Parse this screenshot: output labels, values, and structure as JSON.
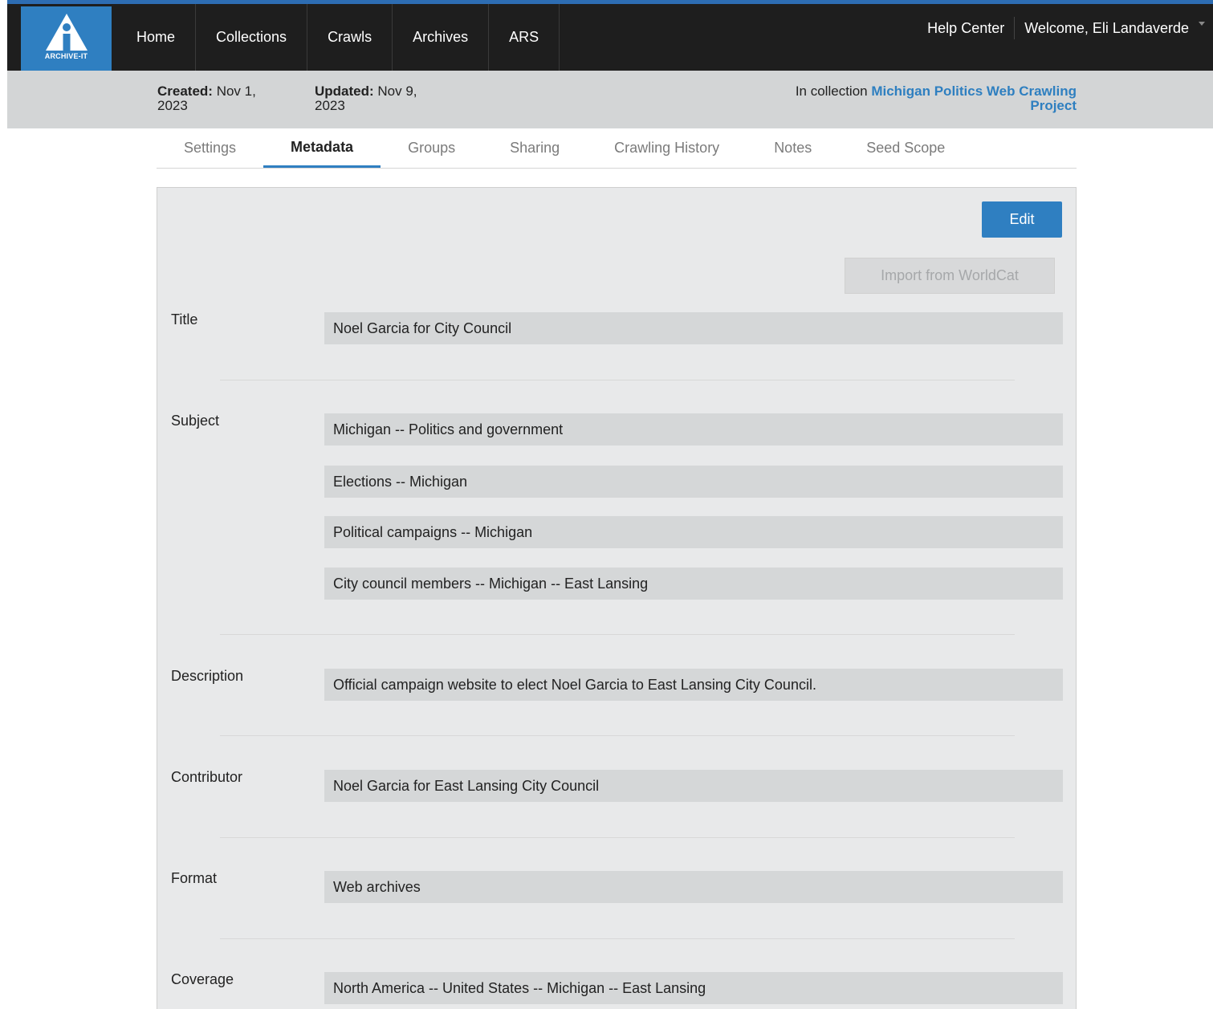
{
  "logo": {
    "text": "ARCHIVE-IT"
  },
  "nav": {
    "items": [
      "Home",
      "Collections",
      "Crawls",
      "Archives",
      "ARS"
    ],
    "help": "Help Center",
    "welcome": "Welcome, Eli Landaverde"
  },
  "info": {
    "created_label": "Created:",
    "created_value": " Nov 1, 2023",
    "updated_label": "Updated:",
    "updated_value": " Nov 9, 2023",
    "collection_prefix": "In collection ",
    "collection_line1": "Michigan Politics Web Crawling",
    "collection_line2": "Project"
  },
  "tabs": [
    "Settings",
    "Metadata",
    "Groups",
    "Sharing",
    "Crawling History",
    "Notes",
    "Seed Scope"
  ],
  "active_tab": "Metadata",
  "buttons": {
    "edit": "Edit",
    "import": "Import from WorldCat"
  },
  "metadata": {
    "title_label": "Title",
    "title": "Noel Garcia for City Council",
    "subject_label": "Subject",
    "subjects": [
      "Michigan -- Politics and government",
      "Elections -- Michigan",
      "Political campaigns -- Michigan",
      "City council members -- Michigan -- East Lansing"
    ],
    "description_label": "Description",
    "description": "Official campaign website to elect Noel Garcia to East Lansing City Council.",
    "contributor_label": "Contributor",
    "contributor": "Noel Garcia for East Lansing City Council",
    "format_label": "Format",
    "format": "Web archives",
    "coverage_label": "Coverage",
    "coverage": "North America -- United States -- Michigan -- East Lansing"
  },
  "colors": {
    "brand": "#2f7fc1",
    "navbar": "#1e1e1e",
    "infobar": "#d3d5d6",
    "panel": "#e8e9ea"
  }
}
